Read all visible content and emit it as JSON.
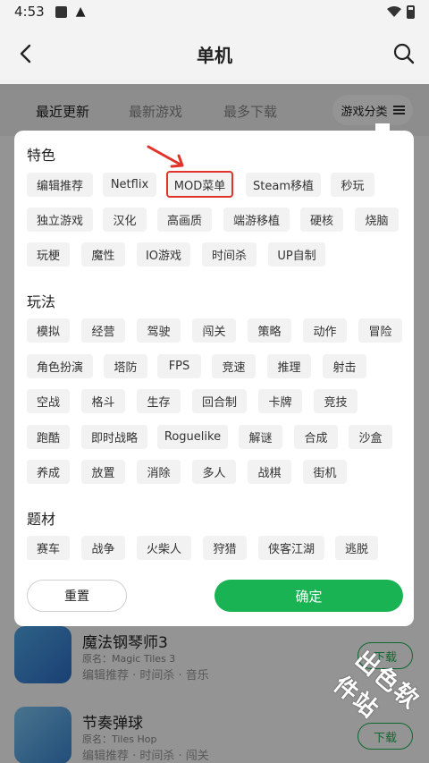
{
  "status_bar": {
    "time": "4:53"
  },
  "header": {
    "title": "单机"
  },
  "tabs": [
    {
      "label": "最近更新",
      "active": true
    },
    {
      "label": "最新游戏",
      "active": false
    },
    {
      "label": "最多下载",
      "active": false
    }
  ],
  "category_button": {
    "label": "游戏分类"
  },
  "sections": [
    {
      "title": "特色",
      "chips": [
        "编辑推荐",
        "Netflix",
        "MOD菜单",
        "Steam移植",
        "秒玩",
        "独立游戏",
        "汉化",
        "高画质",
        "端游移植",
        "硬核",
        "烧脑",
        "玩梗",
        "魔性",
        "IO游戏",
        "时间杀",
        "UP自制"
      ]
    },
    {
      "title": "玩法",
      "chips": [
        "模拟",
        "经营",
        "驾驶",
        "闯关",
        "策略",
        "动作",
        "冒险",
        "角色扮演",
        "塔防",
        "FPS",
        "竞速",
        "推理",
        "射击",
        "空战",
        "格斗",
        "生存",
        "回合制",
        "卡牌",
        "竞技",
        "跑酷",
        "即时战略",
        "Roguelike",
        "解谜",
        "合成",
        "沙盒",
        "养成",
        "放置",
        "消除",
        "多人",
        "战棋",
        "街机"
      ]
    },
    {
      "title": "题材",
      "chips": [
        "赛车",
        "战争",
        "火柴人",
        "狩猎",
        "侠客江湖",
        "逃脱"
      ]
    }
  ],
  "buttons": {
    "reset": "重置",
    "confirm": "确定"
  },
  "games": [
    {
      "name": "魔法钢琴师3",
      "orig": "原名：Magic Tiles 3",
      "tags": "编辑推荐 · 时间杀 · 音乐",
      "download": "下载"
    },
    {
      "name": "节奏弹球",
      "orig": "原名：Tiles Hop",
      "tags": "编辑推荐 · 时间杀 · 闯关",
      "download": "下载"
    }
  ],
  "watermark": "出色软件站",
  "colors": {
    "accent": "#19b354",
    "highlight": "#e0342b",
    "tab_underline": "#a6e8b3"
  }
}
